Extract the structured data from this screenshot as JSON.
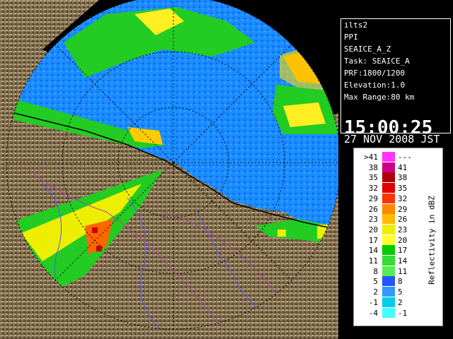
{
  "info": {
    "station": "ilts2",
    "mode": "PPI",
    "product": "SEAICE_A_Z",
    "task": "Task: SEAICE_A",
    "prf": "PRF:1800/1200",
    "elevation": "Elevation:1.0",
    "max_range": "Max Range:80 km",
    "time": "15:00:25",
    "date": "27 NOV 2008 JST"
  },
  "legend": {
    "title": "Reflectivity in dBZ",
    "rows": [
      {
        "lo": ">41",
        "hi": "---",
        "color": "#ff33ff"
      },
      {
        "lo": "38",
        "hi": "41",
        "color": "#cc0088"
      },
      {
        "lo": "35",
        "hi": "38",
        "color": "#b00000"
      },
      {
        "lo": "32",
        "hi": "35",
        "color": "#e00000"
      },
      {
        "lo": "29",
        "hi": "32",
        "color": "#ff3300"
      },
      {
        "lo": "26",
        "hi": "29",
        "color": "#ff8800"
      },
      {
        "lo": "23",
        "hi": "26",
        "color": "#ffbb00"
      },
      {
        "lo": "20",
        "hi": "23",
        "color": "#eeee00"
      },
      {
        "lo": "17",
        "hi": "20",
        "color": "#ffff33"
      },
      {
        "lo": "14",
        "hi": "17",
        "color": "#00cc00"
      },
      {
        "lo": "11",
        "hi": "14",
        "color": "#33dd33"
      },
      {
        "lo": "8",
        "hi": "11",
        "color": "#55ee55"
      },
      {
        "lo": "5",
        "hi": "8",
        "color": "#2255ff"
      },
      {
        "lo": "2",
        "hi": "5",
        "color": "#3399ff"
      },
      {
        "lo": "-1",
        "hi": "2",
        "color": "#00ccee"
      },
      {
        "lo": "-4",
        "hi": "-1",
        "color": "#44ffff"
      }
    ]
  },
  "colors": {
    "sea_echo": "#1e8cff",
    "terrain": "#7a6a50",
    "coast_line": "#000000",
    "range_ring": "#000000"
  }
}
